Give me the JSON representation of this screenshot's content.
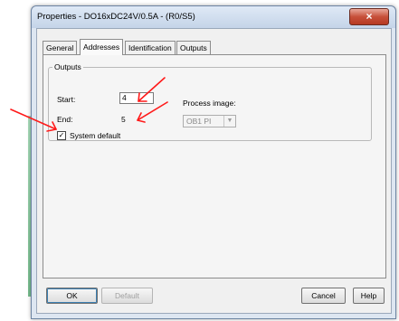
{
  "window": {
    "title": "Properties - DO16xDC24V/0.5A - (R0/S5)",
    "close_glyph": "×"
  },
  "tabs": [
    {
      "label": "General"
    },
    {
      "label": "Addresses",
      "active": true
    },
    {
      "label": "Identification"
    },
    {
      "label": "Outputs"
    }
  ],
  "outputs": {
    "legend": "Outputs",
    "start_label": "Start:",
    "start_value": "4",
    "end_label": "End:",
    "end_value": "5",
    "process_image_label": "Process image:",
    "process_image_value": "OB1 PI",
    "system_default_label": "System default",
    "system_default_checked": true,
    "check_glyph": "✓"
  },
  "buttons": {
    "ok": "OK",
    "default": "Default",
    "cancel": "Cancel",
    "help": "Help"
  },
  "annotation_color": "#ff1a1a"
}
